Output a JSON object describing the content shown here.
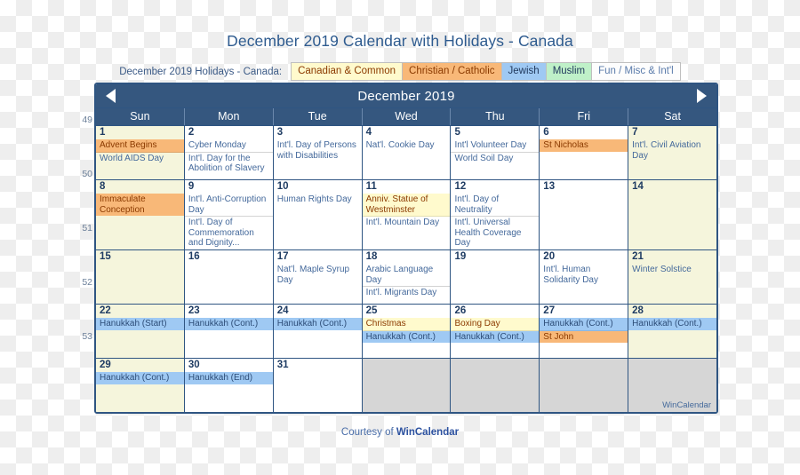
{
  "title": "December 2019 Calendar with Holidays - Canada",
  "legend": {
    "label": "December 2019 Holidays - Canada:",
    "chips": [
      {
        "key": "canadian",
        "label": "Canadian & Common",
        "color": "#FFFACD"
      },
      {
        "key": "christian",
        "label": "Christian / Catholic",
        "color": "#F8B878"
      },
      {
        "key": "jewish",
        "label": "Jewish",
        "color": "#9FC9F3"
      },
      {
        "key": "muslim",
        "label": "Muslim",
        "color": "#BFF0C8"
      },
      {
        "key": "fun",
        "label": "Fun / Misc & Int'l",
        "color": "#FDFDFD"
      }
    ]
  },
  "calendar": {
    "month_title": "December 2019",
    "prev_icon": "triangle-left-icon",
    "next_icon": "triangle-right-icon",
    "day_headers": [
      "Sun",
      "Mon",
      "Tue",
      "Wed",
      "Thu",
      "Fri",
      "Sat"
    ],
    "week_numbers": [
      "49",
      "50",
      "51",
      "52",
      "53"
    ],
    "watermark": "WinCalendar",
    "weeks": [
      {
        "number": "49",
        "days": [
          {
            "num": "1",
            "weekend": true,
            "events": [
              {
                "cat": "christian",
                "text": "Advent Begins"
              },
              {
                "cat": "fun",
                "text": "World AIDS Day"
              }
            ]
          },
          {
            "num": "2",
            "weekend": false,
            "events": [
              {
                "cat": "fun",
                "text": "Cyber Monday"
              },
              {
                "cat": "fun",
                "text": "Int'l. Day for the Abolition of Slavery"
              }
            ]
          },
          {
            "num": "3",
            "weekend": false,
            "events": [
              {
                "cat": "fun",
                "text": "Int'l. Day of Persons with Disabilities"
              }
            ]
          },
          {
            "num": "4",
            "weekend": false,
            "events": [
              {
                "cat": "fun",
                "text": "Nat'l. Cookie Day"
              }
            ]
          },
          {
            "num": "5",
            "weekend": false,
            "events": [
              {
                "cat": "fun",
                "text": "Int'l Volunteer Day"
              },
              {
                "cat": "fun",
                "text": "World Soil Day"
              }
            ]
          },
          {
            "num": "6",
            "weekend": false,
            "events": [
              {
                "cat": "christian",
                "text": "St Nicholas"
              }
            ]
          },
          {
            "num": "7",
            "weekend": true,
            "events": [
              {
                "cat": "fun",
                "text": "Int'l. Civil Aviation Day"
              }
            ]
          }
        ]
      },
      {
        "number": "50",
        "days": [
          {
            "num": "8",
            "weekend": true,
            "events": [
              {
                "cat": "christian",
                "text": "Immaculate Conception"
              }
            ]
          },
          {
            "num": "9",
            "weekend": false,
            "events": [
              {
                "cat": "fun",
                "text": "Int'l. Anti-Corruption Day"
              },
              {
                "cat": "fun",
                "text": "Int'l. Day of Commemoration and Dignity..."
              }
            ]
          },
          {
            "num": "10",
            "weekend": false,
            "events": [
              {
                "cat": "fun",
                "text": "Human Rights Day"
              }
            ]
          },
          {
            "num": "11",
            "weekend": false,
            "events": [
              {
                "cat": "canadian",
                "text": "Anniv. Statue of Westminster"
              },
              {
                "cat": "fun",
                "text": "Int'l. Mountain Day"
              }
            ]
          },
          {
            "num": "12",
            "weekend": false,
            "events": [
              {
                "cat": "fun",
                "text": "Int'l. Day of Neutrality"
              },
              {
                "cat": "fun",
                "text": "Int'l. Universal Health Coverage Day"
              }
            ]
          },
          {
            "num": "13",
            "weekend": false,
            "events": []
          },
          {
            "num": "14",
            "weekend": true,
            "events": []
          }
        ]
      },
      {
        "number": "51",
        "days": [
          {
            "num": "15",
            "weekend": true,
            "events": []
          },
          {
            "num": "16",
            "weekend": false,
            "events": []
          },
          {
            "num": "17",
            "weekend": false,
            "events": [
              {
                "cat": "fun",
                "text": "Nat'l. Maple Syrup Day"
              }
            ]
          },
          {
            "num": "18",
            "weekend": false,
            "events": [
              {
                "cat": "fun",
                "text": "Arabic Language Day"
              },
              {
                "cat": "fun",
                "text": "Int'l. Migrants Day"
              }
            ]
          },
          {
            "num": "19",
            "weekend": false,
            "events": []
          },
          {
            "num": "20",
            "weekend": false,
            "events": [
              {
                "cat": "fun",
                "text": "Int'l. Human Solidarity Day"
              }
            ]
          },
          {
            "num": "21",
            "weekend": true,
            "events": [
              {
                "cat": "fun",
                "text": "Winter Solstice"
              }
            ]
          }
        ]
      },
      {
        "number": "52",
        "days": [
          {
            "num": "22",
            "weekend": true,
            "events": [
              {
                "cat": "jewish",
                "text": "Hanukkah (Start)"
              }
            ]
          },
          {
            "num": "23",
            "weekend": false,
            "events": [
              {
                "cat": "jewish",
                "text": "Hanukkah (Cont.)"
              }
            ]
          },
          {
            "num": "24",
            "weekend": false,
            "events": [
              {
                "cat": "jewish",
                "text": "Hanukkah (Cont.)"
              }
            ]
          },
          {
            "num": "25",
            "weekend": false,
            "events": [
              {
                "cat": "canadian",
                "text": "Christmas"
              },
              {
                "cat": "jewish",
                "text": "Hanukkah (Cont.)"
              }
            ]
          },
          {
            "num": "26",
            "weekend": false,
            "events": [
              {
                "cat": "canadian",
                "text": "Boxing Day"
              },
              {
                "cat": "jewish",
                "text": "Hanukkah (Cont.)"
              }
            ]
          },
          {
            "num": "27",
            "weekend": false,
            "events": [
              {
                "cat": "jewish",
                "text": "Hanukkah (Cont.)"
              },
              {
                "cat": "christian",
                "text": "St John"
              }
            ]
          },
          {
            "num": "28",
            "weekend": true,
            "events": [
              {
                "cat": "jewish",
                "text": "Hanukkah (Cont.)"
              }
            ]
          }
        ]
      },
      {
        "number": "53",
        "days": [
          {
            "num": "29",
            "weekend": true,
            "events": [
              {
                "cat": "jewish",
                "text": "Hanukkah (Cont.)"
              }
            ]
          },
          {
            "num": "30",
            "weekend": false,
            "events": [
              {
                "cat": "jewish",
                "text": "Hanukkah (End)"
              }
            ]
          },
          {
            "num": "31",
            "weekend": false,
            "events": []
          },
          {
            "num": "",
            "weekend": false,
            "blank": true,
            "events": []
          },
          {
            "num": "",
            "weekend": false,
            "blank": true,
            "events": []
          },
          {
            "num": "",
            "weekend": false,
            "blank": true,
            "events": []
          },
          {
            "num": "",
            "weekend": false,
            "blank": true,
            "events": []
          }
        ]
      }
    ]
  },
  "footer": {
    "prefix": "Courtesy of ",
    "brand": "WinCalendar"
  }
}
